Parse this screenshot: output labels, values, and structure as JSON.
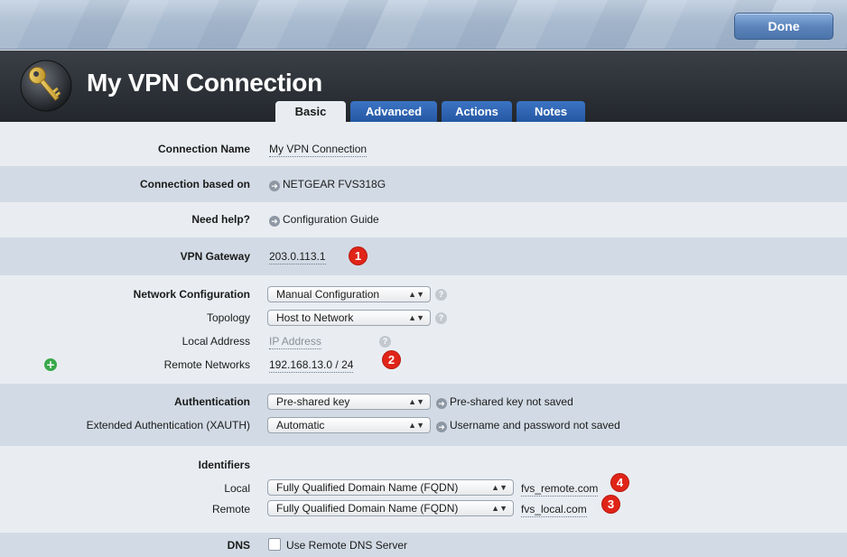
{
  "toolbar": {
    "done_label": "Done"
  },
  "header": {
    "title": "My VPN Connection",
    "icon": "key-icon"
  },
  "tabs": [
    {
      "label": "Basic",
      "active": true
    },
    {
      "label": "Advanced",
      "active": false
    },
    {
      "label": "Actions",
      "active": false
    },
    {
      "label": "Notes",
      "active": false
    }
  ],
  "form": {
    "connection_name": {
      "label": "Connection Name",
      "value": "My VPN Connection"
    },
    "based_on": {
      "label": "Connection based on",
      "value": "NETGEAR FVS318G"
    },
    "help": {
      "label": "Need help?",
      "value": "Configuration Guide"
    },
    "gateway": {
      "label": "VPN Gateway",
      "value": "203.0.113.1",
      "badge": "1"
    },
    "network_config": {
      "label": "Network Configuration",
      "value": "Manual Configuration",
      "help": "?"
    },
    "topology": {
      "label": "Topology",
      "value": "Host to Network",
      "help": "?"
    },
    "local_address": {
      "label": "Local Address",
      "placeholder": "IP Address",
      "help": "?"
    },
    "remote_networks": {
      "label": "Remote Networks",
      "value": "192.168.13.0 / 24",
      "badge": "2",
      "add": "+"
    },
    "authentication": {
      "label": "Authentication",
      "value": "Pre-shared key",
      "status": "Pre-shared key not saved"
    },
    "xauth": {
      "label": "Extended Authentication (XAUTH)",
      "value": "Automatic",
      "status": "Username and password not saved"
    },
    "identifiers": {
      "label": "Identifiers",
      "local": {
        "label": "Local",
        "type": "Fully Qualified Domain Name (FQDN)",
        "value": "fvs_remote.com",
        "badge": "4"
      },
      "remote": {
        "label": "Remote",
        "type": "Fully Qualified Domain Name (FQDN)",
        "value": "fvs_local.com",
        "badge": "3"
      }
    },
    "dns": {
      "label": "DNS",
      "checkbox_label": "Use Remote DNS Server",
      "checked": false
    }
  },
  "colors": {
    "badge": "#e02418",
    "tab": "#2d62b0",
    "header": "#2a2e33",
    "row_dark": "#d2dbe5",
    "row_light": "#e9edf2"
  }
}
